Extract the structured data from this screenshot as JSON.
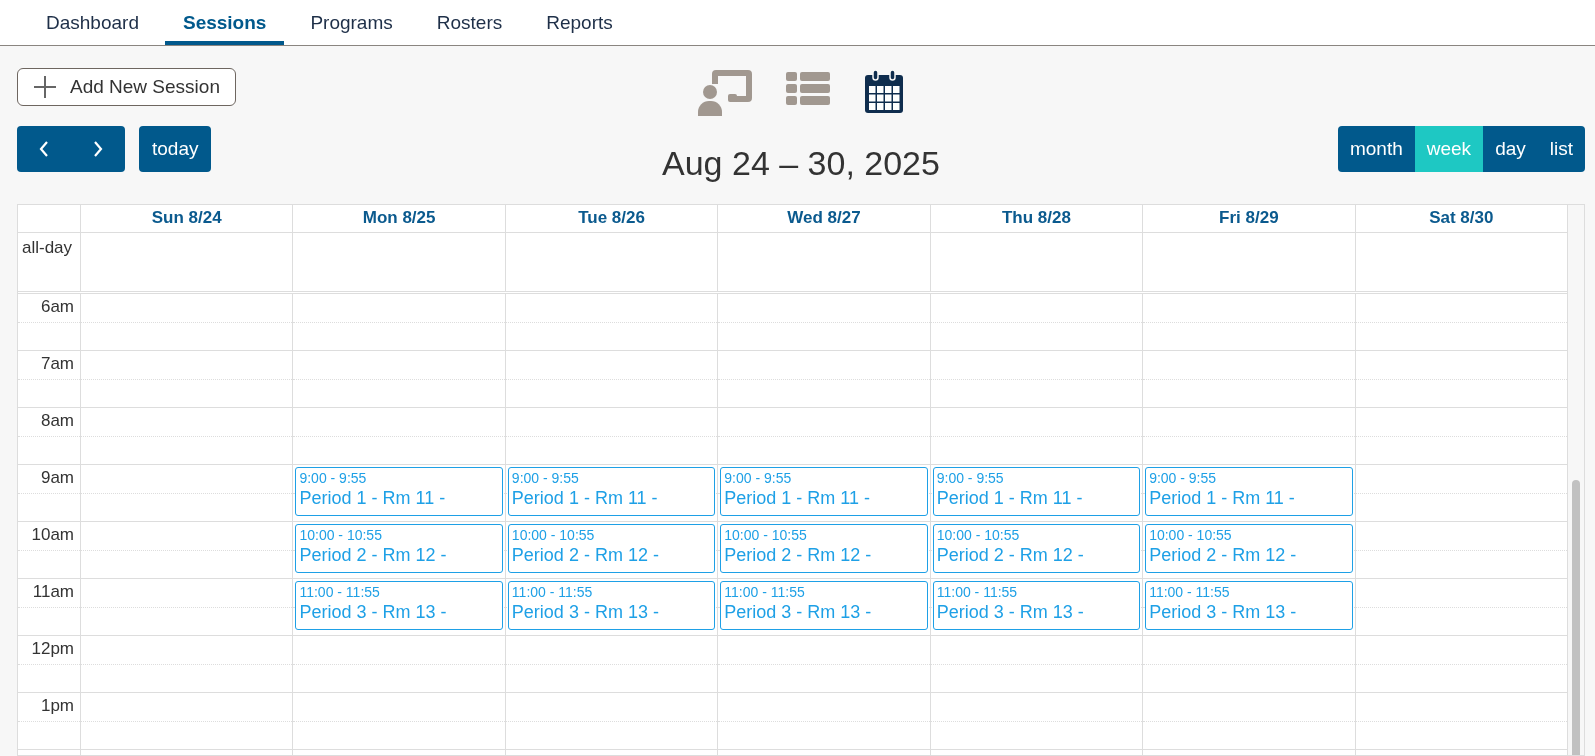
{
  "nav_tabs": [
    {
      "label": "Dashboard",
      "selected": false
    },
    {
      "label": "Sessions",
      "selected": true
    },
    {
      "label": "Programs",
      "selected": false
    },
    {
      "label": "Rosters",
      "selected": false
    },
    {
      "label": "Reports",
      "selected": false
    }
  ],
  "add_button": {
    "label": "Add New Session"
  },
  "view_icons": [
    {
      "kind": "presenter",
      "selected": false
    },
    {
      "kind": "list",
      "selected": false
    },
    {
      "kind": "calendar",
      "selected": true
    }
  ],
  "today_button": {
    "label": "today"
  },
  "title": "Aug 24 – 30, 2025",
  "view_buttons": [
    {
      "label": "month",
      "selected": false
    },
    {
      "label": "week",
      "selected": true
    },
    {
      "label": "day",
      "selected": false
    },
    {
      "label": "list",
      "selected": false
    }
  ],
  "calendar": {
    "days": [
      "Sun 8/24",
      "Mon 8/25",
      "Tue 8/26",
      "Wed 8/27",
      "Thu 8/28",
      "Fri 8/29",
      "Sat 8/30"
    ],
    "all_day_label": "all-day",
    "hours": [
      {
        "label": "6am"
      },
      {
        "label": "7am"
      },
      {
        "label": "8am"
      },
      {
        "label": "9am",
        "cells": [
          {
            "kind": "empty"
          },
          {
            "kind": "session",
            "time": "9:00 - 9:55",
            "title": "Period 1 - Rm 11 -"
          },
          {
            "kind": "session",
            "time": "9:00 - 9:55",
            "title": "Period 1 - Rm 11 -"
          },
          {
            "kind": "session",
            "time": "9:00 - 9:55",
            "title": "Period 1 - Rm 11 -"
          },
          {
            "kind": "session",
            "time": "9:00 - 9:55",
            "title": "Period 1 - Rm 11 -"
          },
          {
            "kind": "session",
            "time": "9:00 - 9:55",
            "title": "Period 1 - Rm 11 -"
          },
          {
            "kind": "empty"
          }
        ]
      },
      {
        "label": "10am",
        "cells": [
          {
            "kind": "empty"
          },
          {
            "kind": "session",
            "time": "10:00 - 10:55",
            "title": "Period 2 - Rm 12 -"
          },
          {
            "kind": "session",
            "time": "10:00 - 10:55",
            "title": "Period 2 - Rm 12 -"
          },
          {
            "kind": "session",
            "time": "10:00 - 10:55",
            "title": "Period 2 - Rm 12 -"
          },
          {
            "kind": "session",
            "time": "10:00 - 10:55",
            "title": "Period 2 - Rm 12 -"
          },
          {
            "kind": "session",
            "time": "10:00 - 10:55",
            "title": "Period 2 - Rm 12 -"
          },
          {
            "kind": "empty"
          }
        ]
      },
      {
        "label": "11am",
        "cells": [
          {
            "kind": "empty"
          },
          {
            "kind": "session",
            "time": "11:00 - 11:55",
            "title": "Period 3 - Rm 13 -"
          },
          {
            "kind": "session",
            "time": "11:00 - 11:55",
            "title": "Period 3 - Rm 13 -"
          },
          {
            "kind": "session",
            "time": "11:00 - 11:55",
            "title": "Period 3 - Rm 13 -"
          },
          {
            "kind": "session",
            "time": "11:00 - 11:55",
            "title": "Period 3 - Rm 13 -"
          },
          {
            "kind": "session",
            "time": "11:00 - 11:55",
            "title": "Period 3 - Rm 13 -"
          },
          {
            "kind": "empty"
          }
        ]
      },
      {
        "label": "12pm"
      },
      {
        "label": "1pm"
      }
    ]
  }
}
